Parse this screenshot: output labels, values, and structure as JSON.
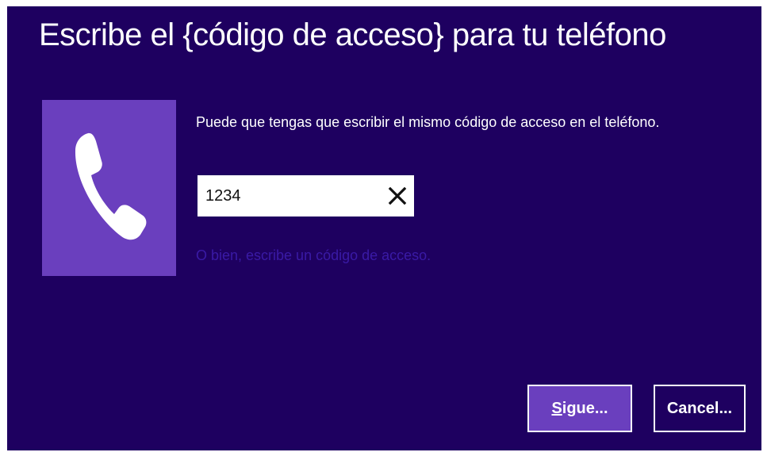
{
  "dialog": {
    "title": "Escribe el {código de acceso} para tu teléfono",
    "tile_icon": "phone-icon",
    "hint": "Puede que tengas que escribir el mismo código de acceso en el teléfono.",
    "code_value": "1234",
    "clear_icon": "close-icon",
    "alt_link": "O bien, escribe un código de acceso.",
    "next_label": "Sigue...",
    "cancel_label": "Cancel..."
  },
  "colors": {
    "background": "#1e0060",
    "tile": "#6a3fbe",
    "link": "#3a1aa6",
    "text": "#ffffff"
  }
}
